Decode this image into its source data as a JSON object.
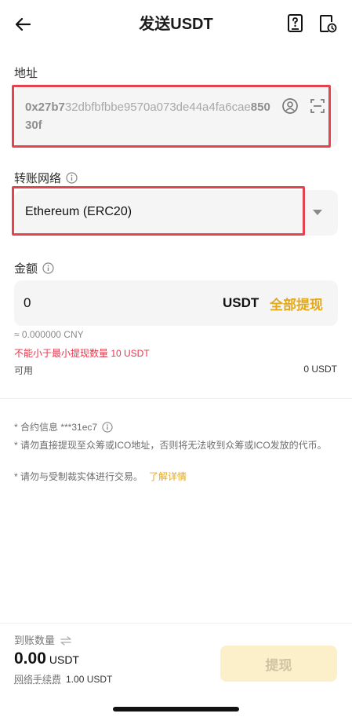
{
  "header": {
    "title": "发送USDT",
    "back_icon": "arrow-left-icon",
    "help_icon": "help-document-icon",
    "history_icon": "history-document-icon"
  },
  "address": {
    "label": "地址",
    "value_prefix_bold": "0x27b7",
    "value_middle": "32dbfbfbbe9570a073de44a4fa6cae",
    "value_suffix_bold": "85030f",
    "contact_icon": "contact-book-icon",
    "scan_icon": "scan-icon"
  },
  "network": {
    "label": "转账网络",
    "value": "Ethereum (ERC20)",
    "info_icon": "info-icon",
    "caret_icon": "caret-down-icon"
  },
  "amount": {
    "label": "金额",
    "value": "0",
    "unit": "USDT",
    "max_label": "全部提现",
    "cny_estimate": "≈ 0.000000 CNY",
    "min_warning": "不能小于最小提现数量 10 USDT",
    "available_label": "可用",
    "available_value": "0 USDT"
  },
  "notes": {
    "contract": "* 合约信息 ***31ec7",
    "ico_warning": "* 请勿直接提现至众筹或ICO地址，否则将无法收到众筹或ICO发放的代币。",
    "sanction_warning": "* 请勿与受制裁实体进行交易。",
    "learn_more": "了解详情"
  },
  "footer": {
    "receive_label": "到账数量",
    "receive_amount": "0.00",
    "receive_unit": "USDT",
    "fee_label": "网络手续费",
    "fee_value": "1.00 USDT",
    "withdraw_label": "提现"
  },
  "colors": {
    "accent": "#e4a91a",
    "warning": "#e8344a",
    "highlight_frame": "#e5424f",
    "disabled_button": "#fcf0cb"
  }
}
